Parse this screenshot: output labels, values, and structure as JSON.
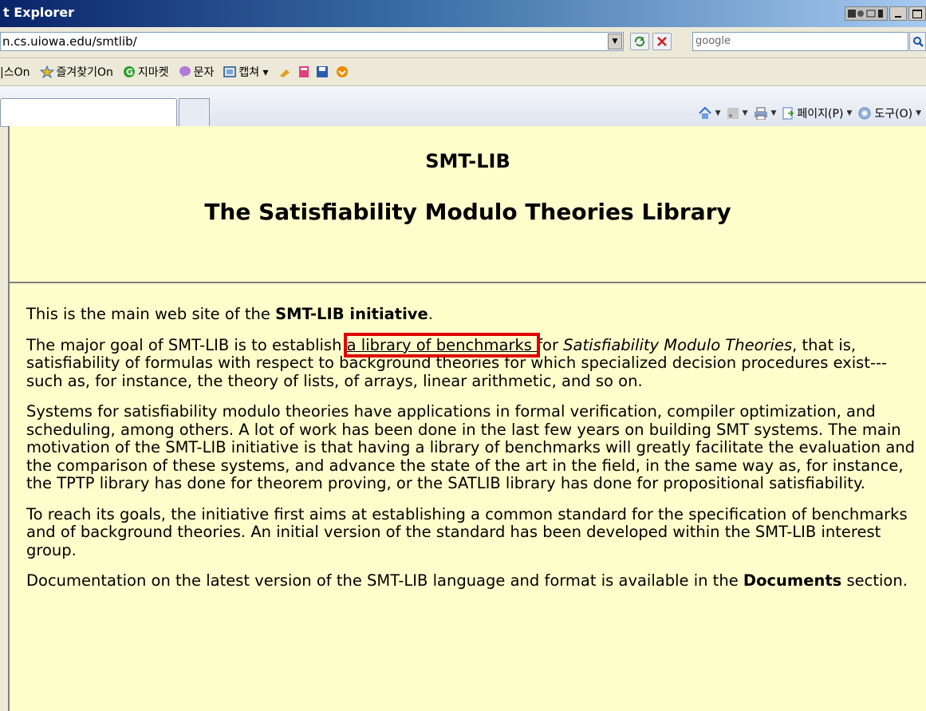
{
  "window": {
    "title": "t Explorer"
  },
  "address": {
    "url": "n.cs.uiowa.edu/smtlib/"
  },
  "search": {
    "placeholder": "google"
  },
  "favorites": [
    {
      "label": "|스On",
      "icon": "news-icon"
    },
    {
      "label": "즐겨찾기On",
      "icon": "favorites-star-icon"
    },
    {
      "label": "지마켓",
      "icon": "gmarket-icon"
    },
    {
      "label": "문자",
      "icon": "message-icon"
    },
    {
      "label": "캡쳐 ▾",
      "icon": "capture-icon"
    }
  ],
  "commandbar": {
    "page_label": "페이지(P)",
    "tools_label": "도구(O)"
  },
  "page": {
    "title": "SMT-LIB",
    "subtitle": "The Satisfiability Modulo Theories Library",
    "p1_prefix": "This is the main web site of the ",
    "p1_bold": "SMT-LIB initiative",
    "p1_suffix": ".",
    "p2_prefix": "The major goal of SMT-LIB is to establish ",
    "p2_link": "a library of benchmarks ",
    "p2_mid": "for ",
    "p2_italic": "Satisfiability Modulo Theories",
    "p2_suffix": ", that is, satisfiability of formulas with respect to background theories for which specialized decision procedures exist---such as, for instance, the theory of lists, of arrays, linear arithmetic, and so on.",
    "p3": "Systems for satisfiability modulo theories have applications in formal verification, compiler optimization, and scheduling, among others. A lot of work has been done in the last few years on building SMT systems. The main motivation of the SMT-LIB initiative is that having a library of benchmarks will greatly facilitate the evaluation and the comparison of these systems, and advance the state of the art in the field, in the same way as, for instance, the TPTP library has done for theorem proving, or the SATLIB library has done for propositional satisfiability.",
    "p4": "To reach its goals, the initiative first aims at establishing a common standard for the specification of benchmarks and of background theories. An initial version of the standard has been developed within the SMT-LIB interest group.",
    "p5_prefix": "Documentation on the latest version of the SMT-LIB language and format is available in the ",
    "p5_bold": "Documents",
    "p5_suffix": " section."
  },
  "colors": {
    "page_bg": "#ffffcc",
    "highlight": "#e00000",
    "chrome": "#ece9d8"
  }
}
